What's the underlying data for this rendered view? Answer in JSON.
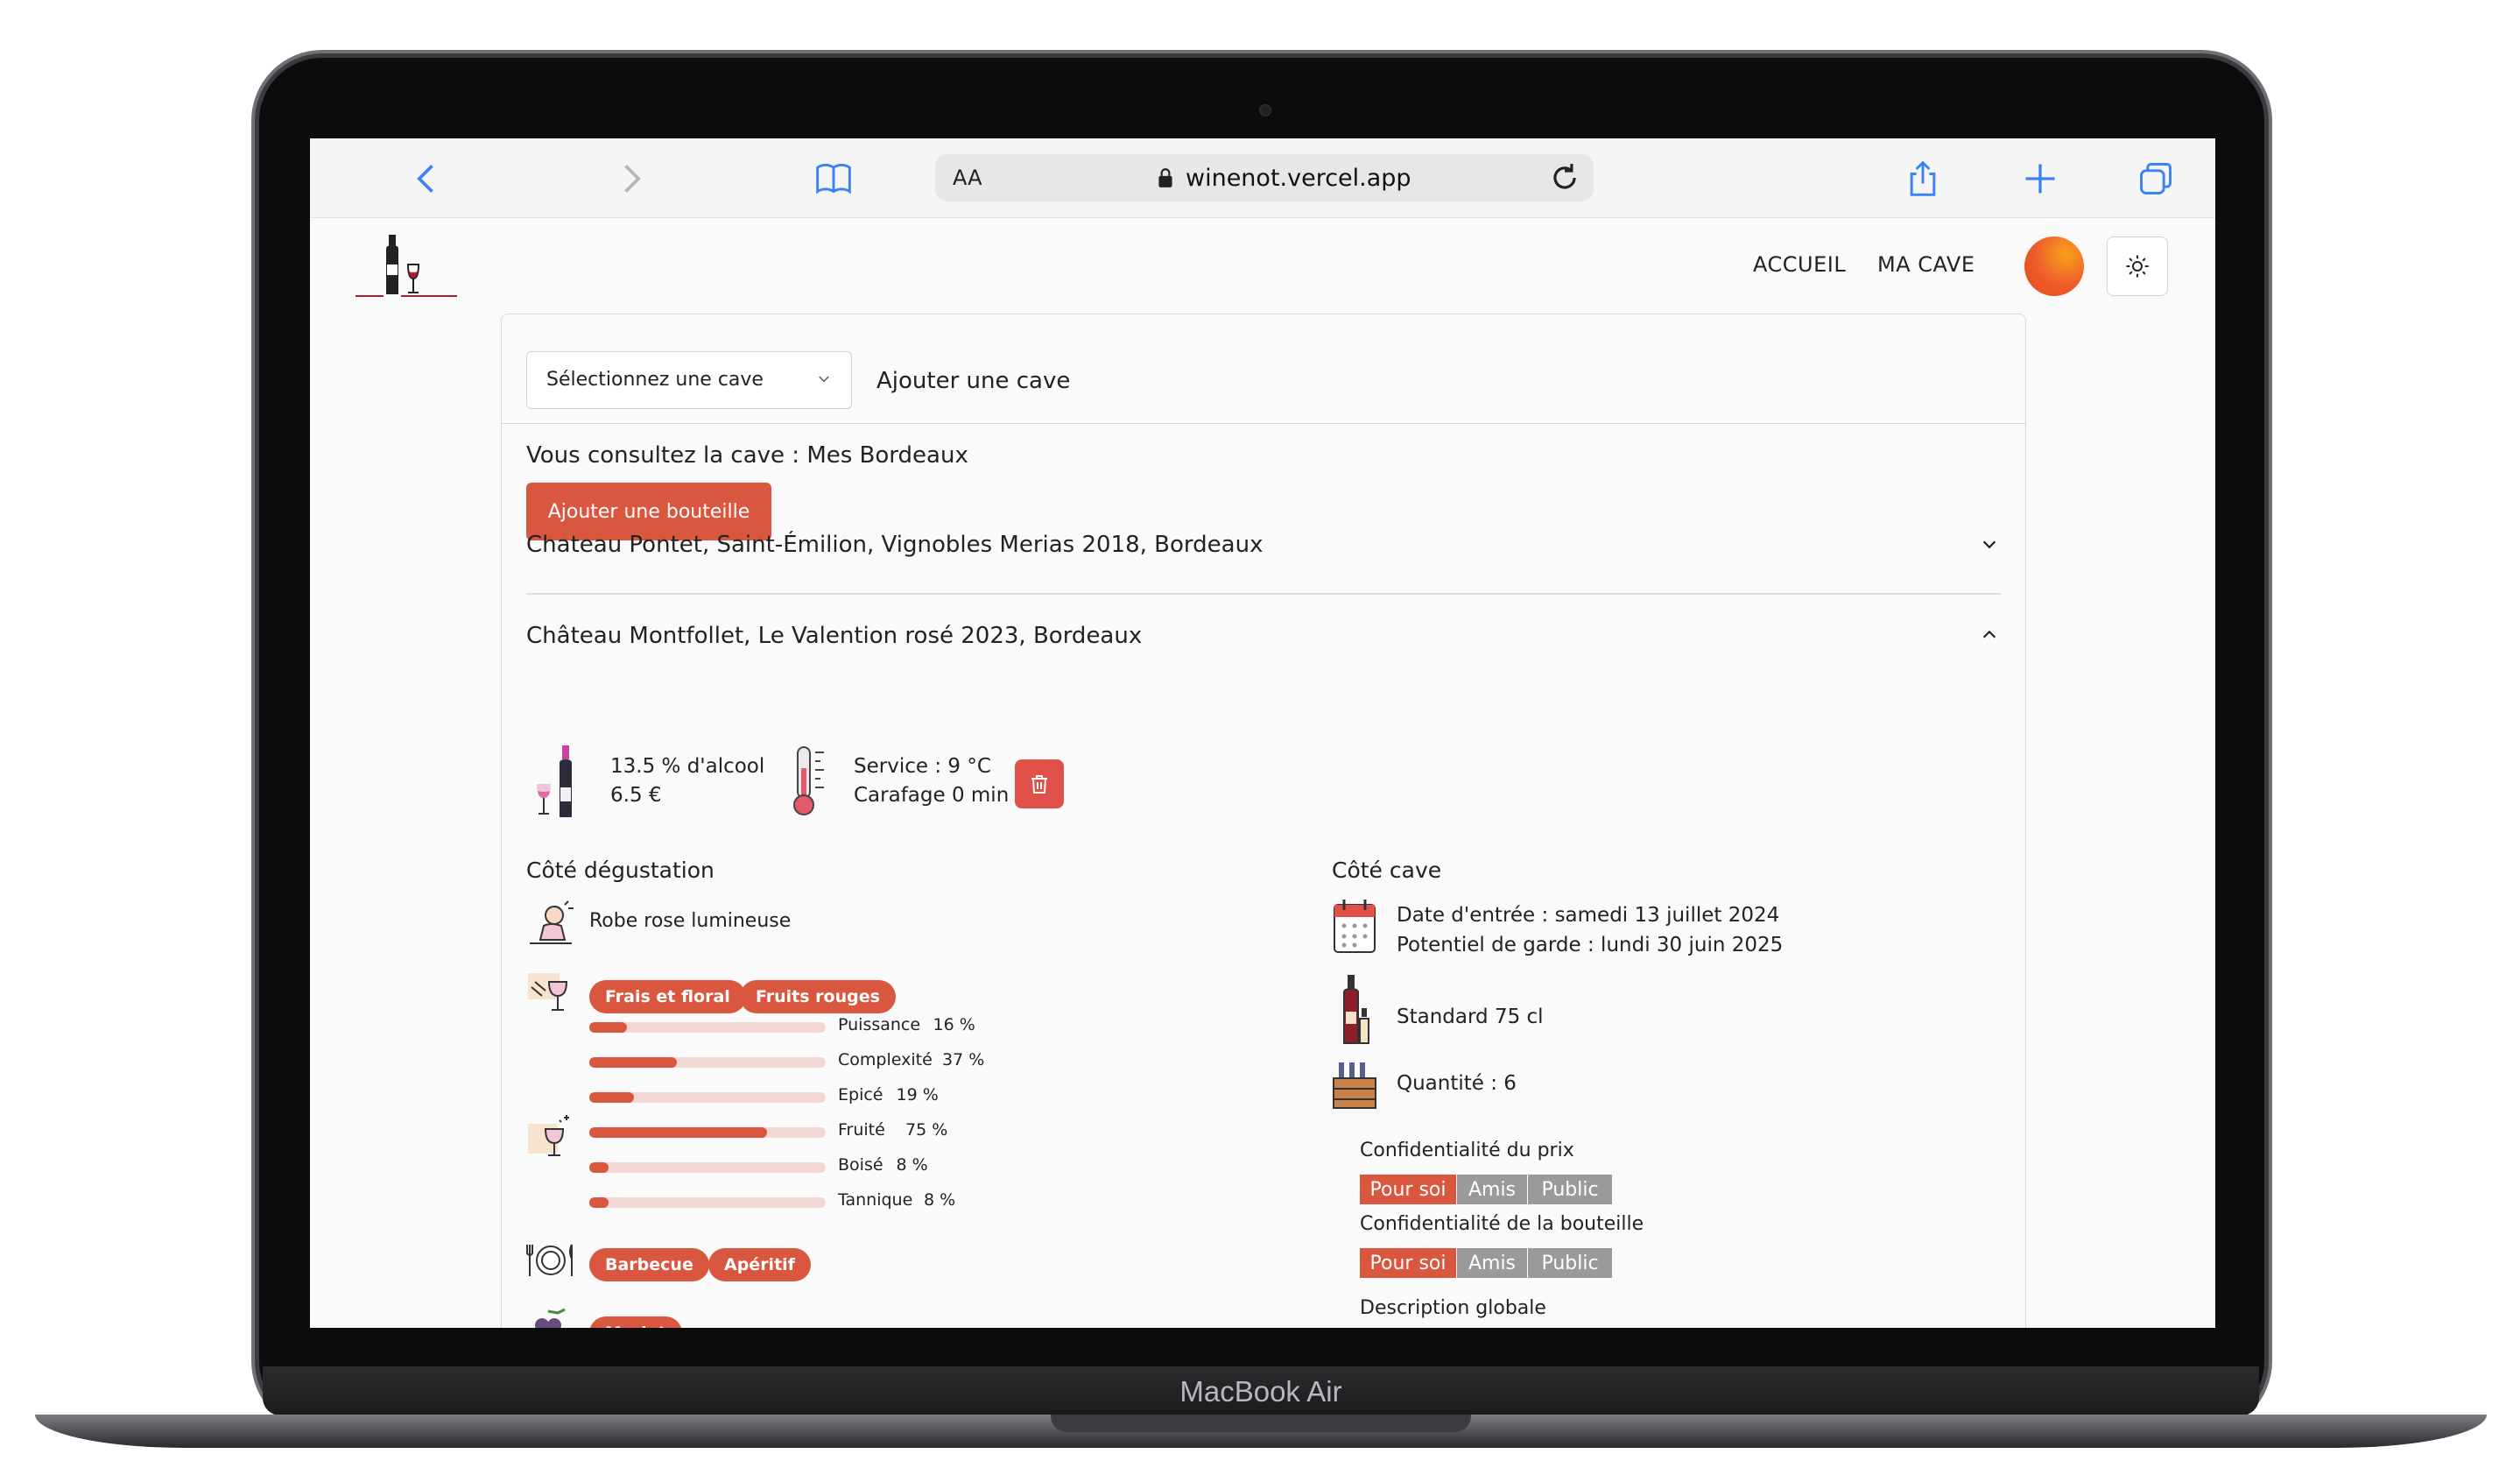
{
  "device": {
    "brand": "MacBook Air"
  },
  "browser": {
    "text_size_label": "AA",
    "url": "winenot.vercel.app"
  },
  "header": {
    "nav": [
      "ACCUEIL",
      "MA CAVE"
    ]
  },
  "cave": {
    "select_placeholder": "Sélectionnez une cave",
    "add_cave_label": "Ajouter une cave",
    "consulting_text": "Vous consultez la cave : Mes Bordeaux",
    "add_bottle_label": "Ajouter une bouteille"
  },
  "wines": [
    {
      "title": "Chateau Pontet, Saint-Émilion, Vignobles Merias 2018, Bordeaux",
      "expanded": false
    },
    {
      "title": "Château Montfollet, Le Valention rosé 2023, Bordeaux",
      "expanded": true
    }
  ],
  "details": {
    "alcohol": "13.5 % d'alcool",
    "price": "6.5 €",
    "service": "Service : 9 °C",
    "carafage": "Carafage 0 min",
    "tasting_title": "Côté dégustation",
    "robe": "Robe rose lumineuse",
    "aromas": [
      "Frais et floral",
      "Fruits rouges"
    ],
    "profile": [
      {
        "label": "Puissance",
        "value": "16 %",
        "pct": 16
      },
      {
        "label": "Complexité",
        "value": "37 %",
        "pct": 37
      },
      {
        "label": "Epicé",
        "value": "19 %",
        "pct": 19
      },
      {
        "label": "Fruité",
        "value": "75 %",
        "pct": 75
      },
      {
        "label": "Boisé",
        "value": "8 %",
        "pct": 8
      },
      {
        "label": "Tannique",
        "value": "8 %",
        "pct": 8
      }
    ],
    "pairings": [
      "Barbecue",
      "Apéritif"
    ],
    "grape": "Merlot",
    "cellar_title": "Côté cave",
    "date_entree": "Date d'entrée : samedi 13 juillet 2024",
    "potentiel": "Potentiel de garde : lundi 30 juin 2025",
    "format": "Standard 75 cl",
    "quantity": "Quantité : 6",
    "price_privacy_label": "Confidentialité du prix",
    "bottle_privacy_label": "Confidentialité de la bouteille",
    "privacy_options": [
      "Pour soi",
      "Amis",
      "Public"
    ],
    "description_label": "Description globale"
  },
  "colors": {
    "accent": "#d9573f",
    "trash": "#e0514a",
    "inactive": "#9a9a9a",
    "browser_blue": "#3b82f6"
  }
}
